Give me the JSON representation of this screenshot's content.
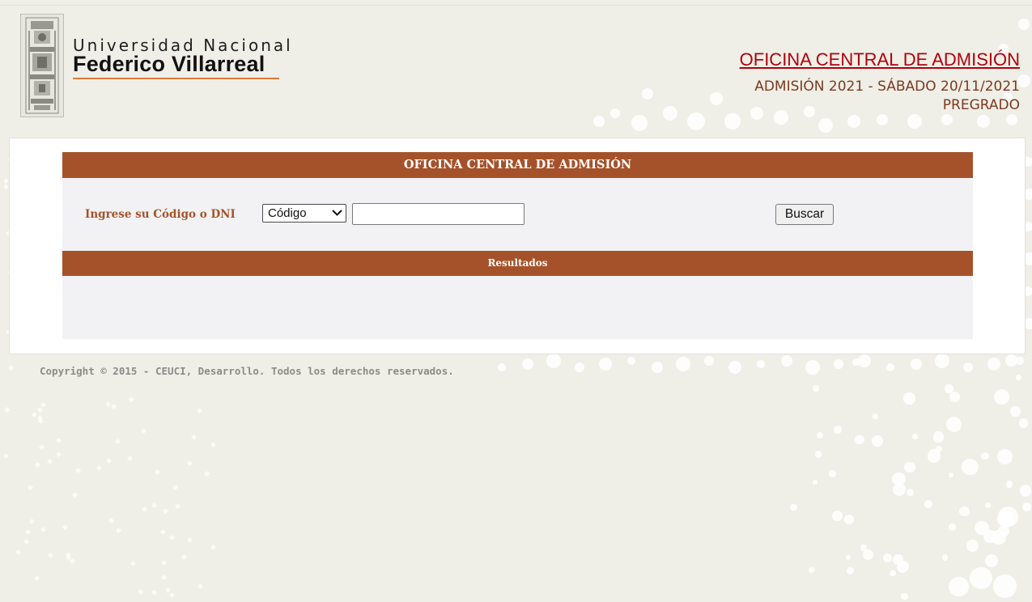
{
  "header": {
    "university_line1": "Universidad Nacional",
    "university_line2": "Federico Villarreal",
    "office_title": "OFICINA CENTRAL DE ADMISIÓN",
    "exam_line": "ADMISIÓN 2021 - SÁBADO 20/11/2021",
    "level": "PREGRADO"
  },
  "search_panel": {
    "title": "OFICINA CENTRAL DE ADMISIÓN",
    "label": "Ingrese su Código o DNI",
    "search_type_selected": "Código",
    "search_value": "",
    "search_button_label": "Buscar"
  },
  "results": {
    "title": "Resultados"
  },
  "footer": {
    "copyright": "Copyright © 2015 - CEUCI, Desarrollo. Todos los derechos reservados."
  },
  "colors": {
    "accent": "#a5522a",
    "title_red": "#b0000c",
    "subtitle_brown": "#7b3a20",
    "page_background": "#f0efe7"
  },
  "icons": {
    "logo": "university-crest-icon",
    "select_arrow": "chevron-down-icon"
  }
}
